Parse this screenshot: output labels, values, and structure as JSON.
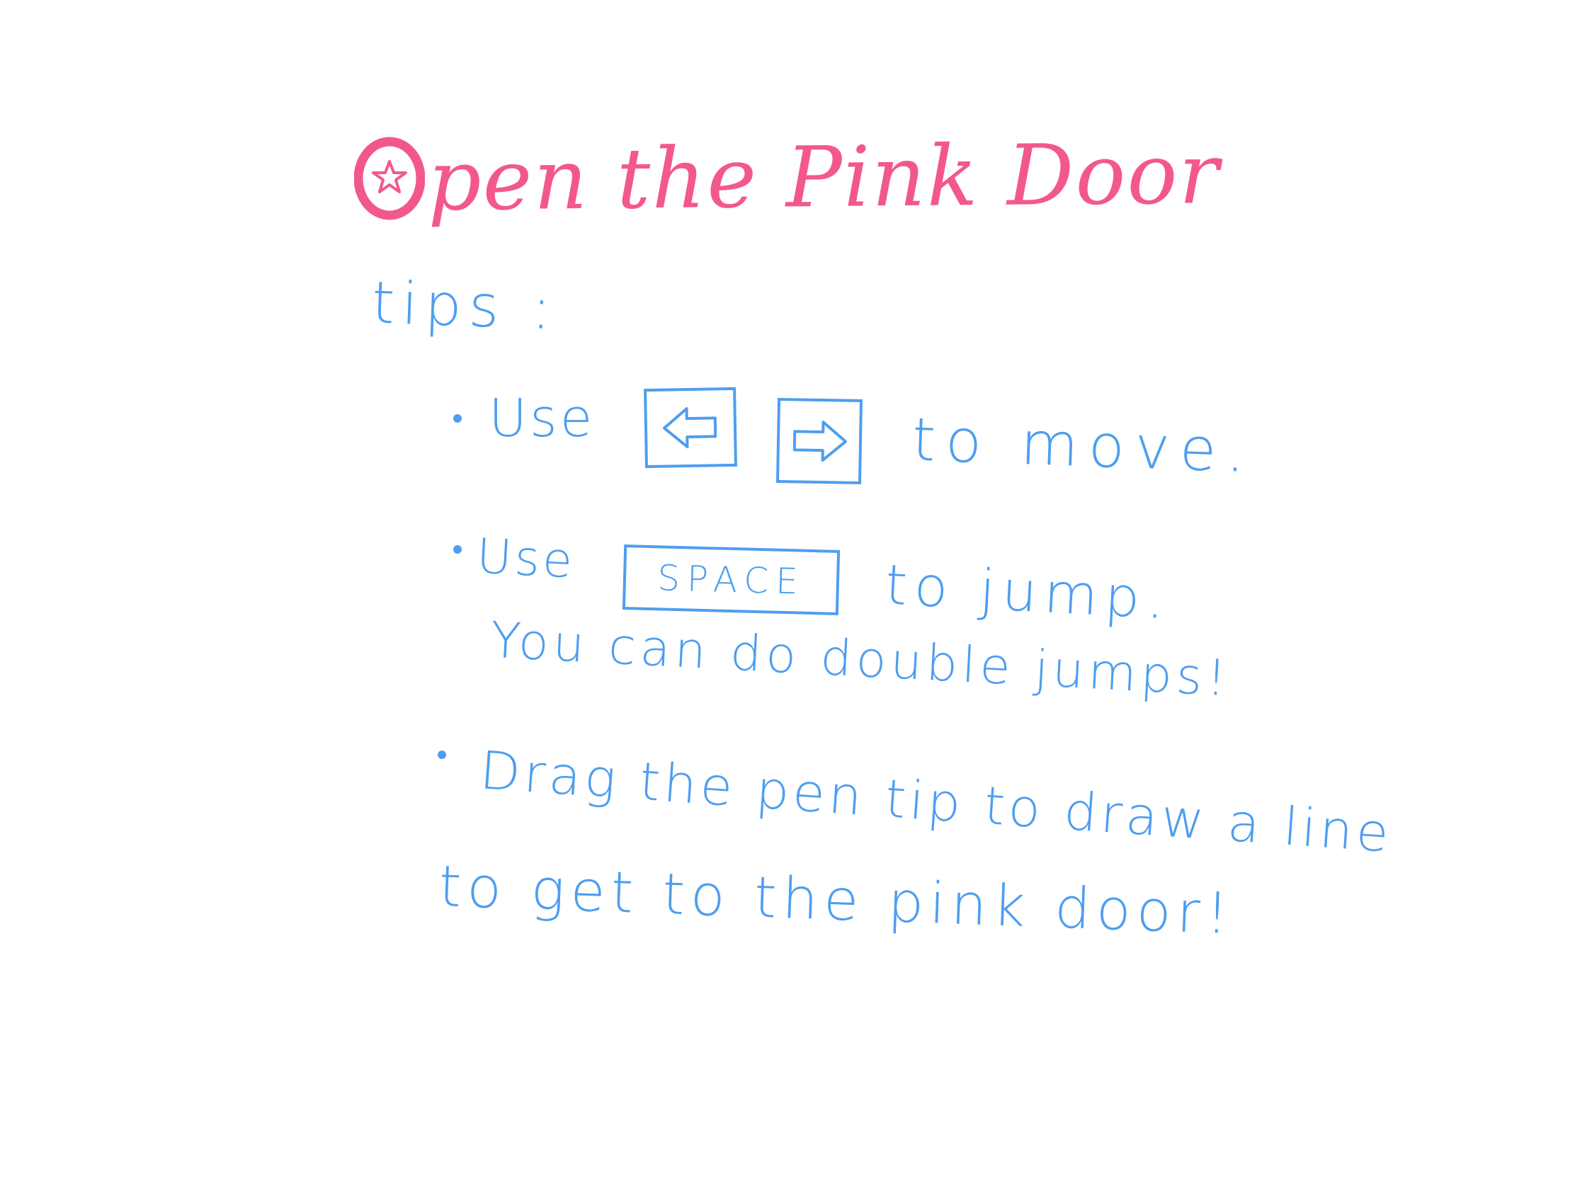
{
  "title": {
    "text": "pen the Pink Door",
    "first_letter_icon": "star-in-circle-letter-O"
  },
  "tips": {
    "heading": "tips :",
    "bullets": [
      {
        "use_word": "Use",
        "keys": [
          {
            "icon": "left-arrow-key-icon"
          },
          {
            "icon": "right-arrow-key-icon"
          }
        ],
        "action": "to move."
      },
      {
        "use_word": "Use",
        "key_label": "SPACE",
        "action": "to jump.",
        "note": "You can do double jumps!"
      },
      {
        "line1": "Drag the pen tip to draw a line",
        "line2": "to get to the pink door!"
      }
    ]
  },
  "colors": {
    "title": "#f2588e",
    "handwriting": "#4e9eef",
    "background": "#ffffff"
  }
}
